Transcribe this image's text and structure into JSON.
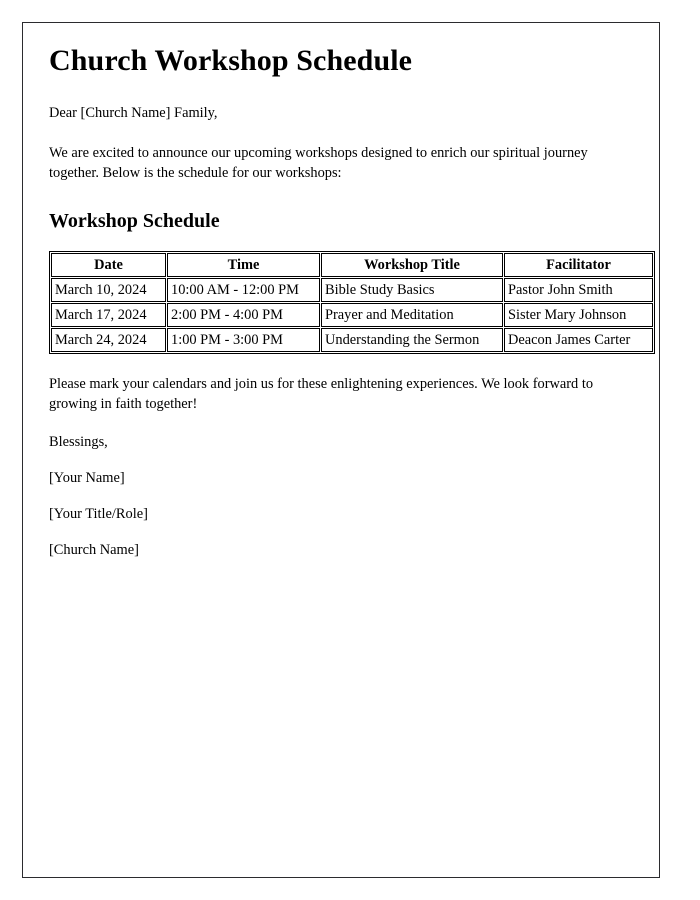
{
  "document": {
    "title": "Church Workshop Schedule",
    "salutation": "Dear [Church Name] Family,",
    "intro_paragraph": "We are excited to announce our upcoming workshops designed to enrich our spiritual journey together. Below is the schedule for our workshops:",
    "section_heading": "Workshop Schedule",
    "closing_paragraph": "Please mark your calendars and join us for these enlightening experiences. We look forward to growing in faith together!",
    "sign_off": "Blessings,",
    "signature_lines": [
      "[Your Name]",
      "[Your Title/Role]",
      "[Church Name]"
    ]
  },
  "schedule_table": {
    "columns": [
      "Date",
      "Time",
      "Workshop Title",
      "Facilitator"
    ],
    "rows": [
      {
        "date": "March 10, 2024",
        "time": "10:00 AM - 12:00 PM",
        "workshop_title": "Bible Study Basics",
        "facilitator": "Pastor John Smith"
      },
      {
        "date": "March 17, 2024",
        "time": "2:00 PM - 4:00 PM",
        "workshop_title": "Prayer and Meditation",
        "facilitator": "Sister Mary Johnson"
      },
      {
        "date": "March 24, 2024",
        "time": "1:00 PM - 3:00 PM",
        "workshop_title": "Understanding the Sermon",
        "facilitator": "Deacon James Carter"
      }
    ]
  },
  "colors": {
    "page_background": "#ffffff",
    "text": "#000000",
    "page_border": "#2b2b2e",
    "table_border": "#000000"
  }
}
